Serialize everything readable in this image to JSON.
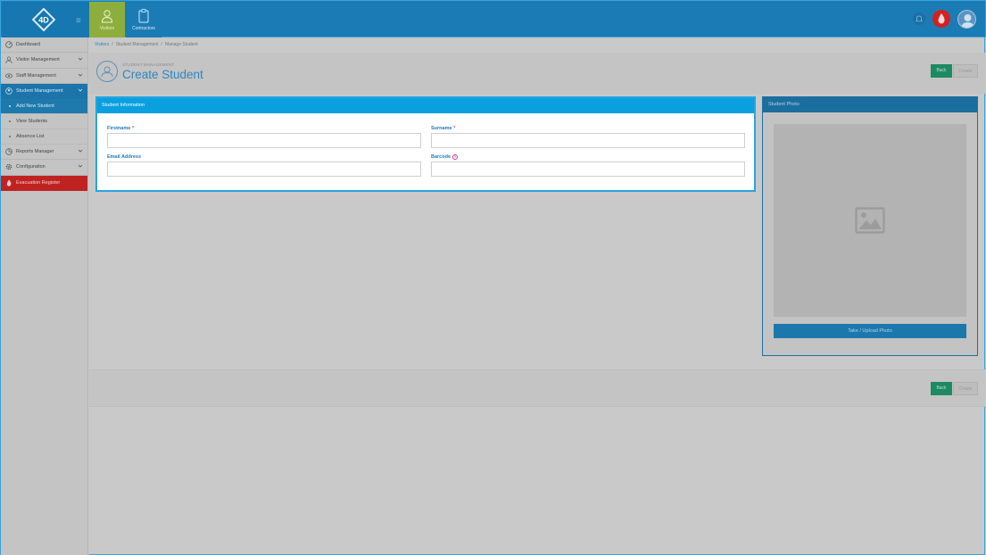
{
  "topbar": {
    "logo_text": "4D",
    "tabs": [
      {
        "label": "Visitors",
        "icon": "person-icon"
      },
      {
        "label": "Contractors",
        "icon": "clipboard-icon"
      }
    ],
    "colors": {
      "bar": "#1b7cb5",
      "active_tab": "#8dae3c",
      "fire": "#d32020"
    }
  },
  "sidebar": {
    "items": [
      {
        "label": "Dashboard",
        "icon": "dashboard-icon"
      },
      {
        "label": "Visitor Management",
        "icon": "person-icon"
      },
      {
        "label": "Staff Management",
        "icon": "eye-icon"
      },
      {
        "label": "Student Management",
        "icon": "student-icon"
      },
      {
        "label": "Add New Student"
      },
      {
        "label": "View Students"
      },
      {
        "label": "Absence List"
      },
      {
        "label": "Reports Manager",
        "icon": "reports-icon"
      },
      {
        "label": "Configuration",
        "icon": "gear-icon"
      },
      {
        "label": "Evacuation Register",
        "icon": "fire-icon"
      }
    ]
  },
  "breadcrumb": [
    "Visitors",
    "Student Management",
    "Manage Student"
  ],
  "page": {
    "supertitle": "STUDENT MANAGEMENT",
    "title": "Create Student"
  },
  "actions": {
    "back": "Back",
    "create": "Create"
  },
  "student_info": {
    "heading": "Student Information",
    "firstname_label": "Firstname",
    "surname_label": "Surname",
    "email_label": "Email Address",
    "barcode_label": "Barcode",
    "required_mark": "*",
    "help_mark": "?",
    "firstname_value": "",
    "surname_value": "",
    "email_value": "",
    "barcode_value": ""
  },
  "student_photo": {
    "heading": "Student Photo",
    "upload_button": "Take / Upload Photo"
  }
}
